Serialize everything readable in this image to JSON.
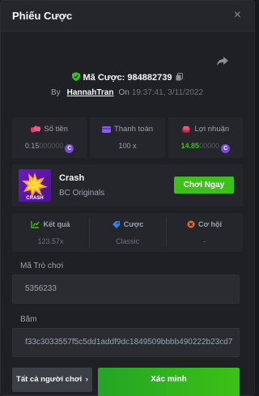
{
  "header": {
    "title": "Phiếu Cược",
    "close_glyph": "×"
  },
  "bet": {
    "id_label": "Mã Cược:",
    "id_value": "984882739",
    "by_label": "By",
    "user": "HannahTran",
    "on_label": "On",
    "time": "19:37:41, 3/11/2022"
  },
  "stats": [
    {
      "label": "Số tiền",
      "value_main": "0.15",
      "value_dim": "000000",
      "icon": "money-icon"
    },
    {
      "label": "Thanh toán",
      "value_main": "100 x",
      "value_dim": "",
      "icon": "card-icon"
    },
    {
      "label": "Lợi nhuận",
      "value_main": "14.85",
      "value_dim": "00000",
      "icon": "profit-icon"
    }
  ],
  "game": {
    "thumb_text": "CRASH",
    "name": "Crash",
    "provider": "BC Originals",
    "play_label": "Chơi Ngay"
  },
  "results": [
    {
      "label": "Kết quả",
      "value": "123.57x",
      "icon": "result-icon"
    },
    {
      "label": "Cược",
      "value": "Classic",
      "icon": "bet-icon"
    },
    {
      "label": "Cơ hội",
      "value": "-",
      "icon": "chance-icon"
    }
  ],
  "fields": {
    "game_id_label": "Mã Trò chơi",
    "game_id_value": "5356233",
    "hash_label": "Băm",
    "hash_value": "f33c3033557f5c5dd1addf9dc1849509bbbb490222b23cd7"
  },
  "footer": {
    "all_players_label": "Tất cả người chơi",
    "verify_label": "Xác minh"
  },
  "colors": {
    "accent_green": "#3bc117",
    "coin_purple": "#7a48e0",
    "background": "#1e2024"
  }
}
